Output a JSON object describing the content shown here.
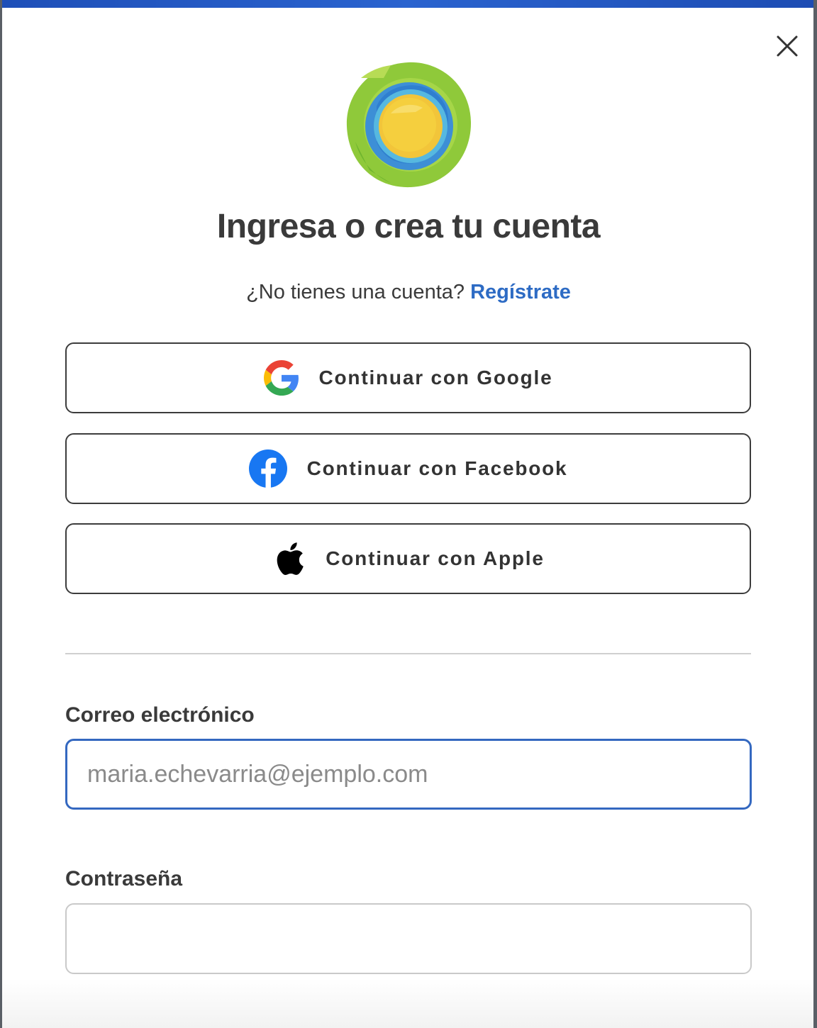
{
  "modal": {
    "title": "Ingresa o crea tu cuenta",
    "subtitle_text": "¿No tienes una cuenta?",
    "register_link": "Regístrate",
    "close_icon": "close-icon",
    "logo_icon": "brand-logo"
  },
  "social": [
    {
      "label": "Continuar con Google",
      "icon": "google-icon"
    },
    {
      "label": "Continuar con Facebook",
      "icon": "facebook-icon"
    },
    {
      "label": "Continuar con Apple",
      "icon": "apple-icon"
    }
  ],
  "form": {
    "email_label": "Correo electrónico",
    "email_placeholder": "maria.echevarria@ejemplo.com",
    "email_value": "",
    "password_label": "Contraseña",
    "password_value": ""
  },
  "colors": {
    "accent": "#2d6bc4",
    "focus_border": "#3468c0",
    "top_bar": "#2a63cf",
    "button_border": "#3c3c3c",
    "facebook": "#1877f2"
  }
}
